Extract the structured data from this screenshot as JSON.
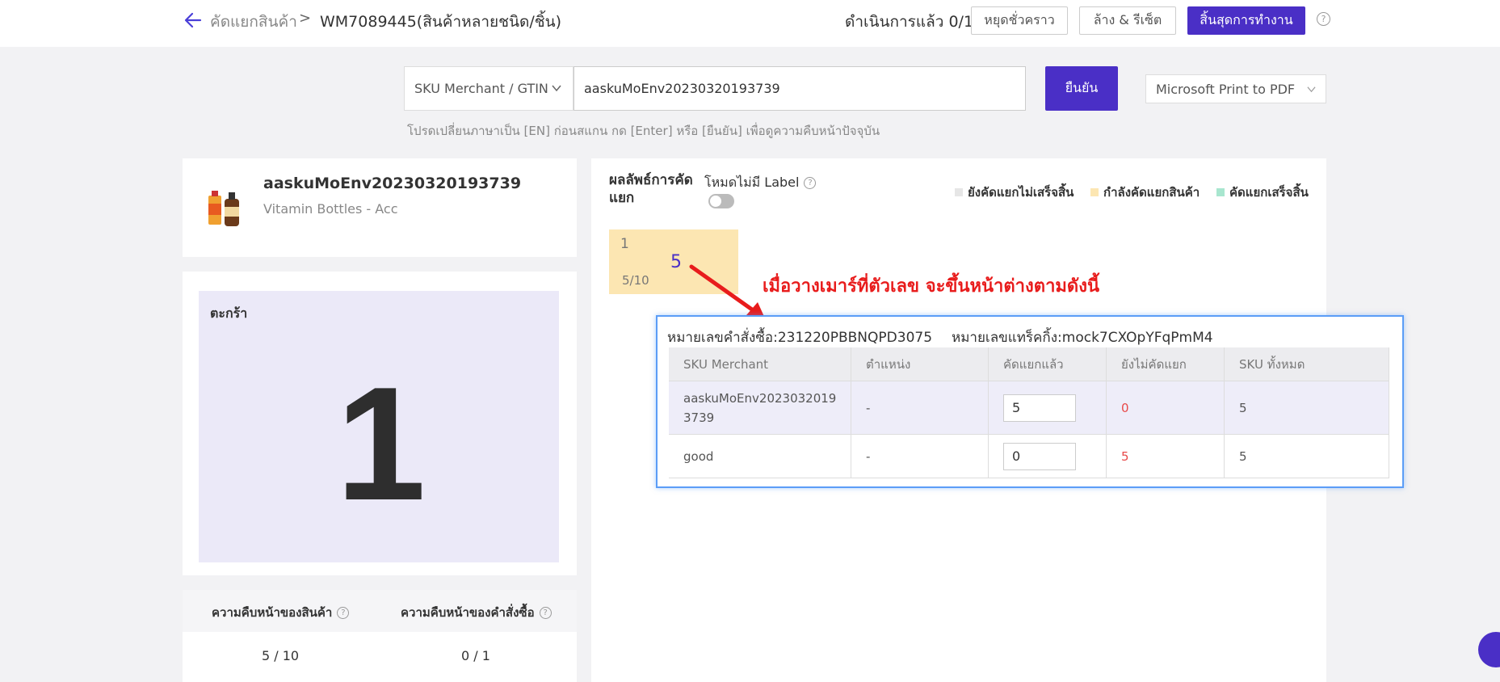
{
  "header": {
    "breadcrumb_root": "คัดแยกสินค้า",
    "breadcrumb_sep": ">",
    "breadcrumb_current": "WM7089445(สินค้าหลายชนิด/ชิ้น)",
    "progress_text": "ดำเนินการแล้ว 0/1",
    "pause_label": "หยุดชั่วคราว",
    "reset_label": "ล้าง & รีเซ็ต",
    "finish_label": "สิ้นสุดการทำงาน",
    "help_icon": "?"
  },
  "scan": {
    "type_select": "SKU Merchant / GTIN",
    "input_value": "aaskuMoEnv20230320193739",
    "confirm_label": "ยืนยัน",
    "printer_select": "Microsoft Print to PDF",
    "hint": "โปรดเปลี่ยนภาษาเป็น [EN] ก่อนสแกน กด [Enter] หรือ [ยืนยัน] เพื่อดูความคืบหน้าปัจจุบัน"
  },
  "product": {
    "sku": "aaskuMoEnv20230320193739",
    "name": "Vitamin Bottles - Acc"
  },
  "basket": {
    "label": "ตะกร้า",
    "number": "1"
  },
  "progress": {
    "product_label": "ความคืบหน้าของสินค้า",
    "order_label": "ความคืบหน้าของคำสั่งซื้อ",
    "product_value": "5 / 10",
    "order_value": "0 / 1"
  },
  "result": {
    "title": "ผลลัพธ์การคัดแยก",
    "nolabel_mode": "โหมดไม่มี Label",
    "legend": [
      {
        "label": "ยังคัดแยกไม่เสร็จสิ้น",
        "color": "#e6e6e6"
      },
      {
        "label": "กำลังคัดแยกสินค้า",
        "color": "#fce6b2"
      },
      {
        "label": "คัดแยกเสร็จสิ้น",
        "color": "#a8e6cf"
      }
    ],
    "tile": {
      "number": "1",
      "count": "5",
      "progress": "5/10"
    }
  },
  "annotation": {
    "text": "เมื่อวางเมาร์ที่ตัวเลข จะขึ้นหน้าต่างตามดังนี้",
    "color": "#e81c1c"
  },
  "popup": {
    "order_no": "หมายเลขคำสั่งซื้อ:231220PBBNQPD3075",
    "tracking_no": "หมายเลขแทร็คกิ้ง:mock7CXOpYFqPmM4",
    "columns": [
      "SKU Merchant",
      "ตำแหน่ง",
      "คัดแยกแล้ว",
      "ยังไม่คัดแยก",
      "SKU ทั้งหมด"
    ],
    "rows": [
      {
        "sku": "aaskuMoEnv20230320193739",
        "location": "-",
        "sorted": "5",
        "unsorted": "0",
        "total": "5"
      },
      {
        "sku": "good",
        "location": "-",
        "sorted": "0",
        "unsorted": "5",
        "total": "5"
      }
    ]
  },
  "colors": {
    "accent": "#4a2fc6",
    "basket_bg": "#ebe9f8",
    "popup_border": "#5b9df7"
  }
}
